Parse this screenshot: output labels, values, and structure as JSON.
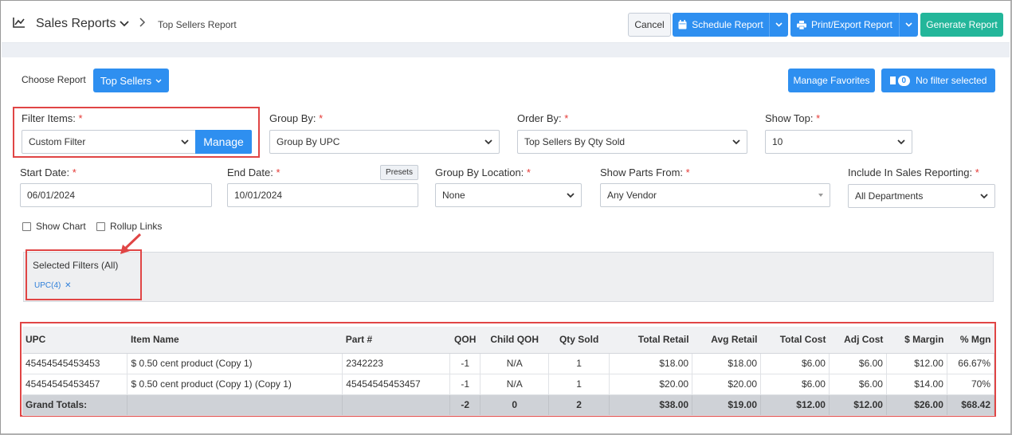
{
  "header": {
    "title": "Sales Reports",
    "subtitle": "Top Sellers Report",
    "cancel_label": "Cancel",
    "schedule_label": "Schedule Report",
    "print_label": "Print/Export Report",
    "generate_label": "Generate Report"
  },
  "choose": {
    "label": "Choose Report",
    "report_button": "Top Sellers",
    "favorites_button": "Manage Favorites",
    "filter_count": "0",
    "filter_status": "No filter selected"
  },
  "form": {
    "filter_items": {
      "label": "Filter Items:",
      "required": "*",
      "value": "Custom Filter",
      "manage": "Manage"
    },
    "group_by": {
      "label": "Group By:",
      "required": "*",
      "value": "Group By UPC"
    },
    "order_by": {
      "label": "Order By:",
      "required": "*",
      "value": "Top Sellers By Qty Sold"
    },
    "show_top": {
      "label": "Show Top:",
      "required": "*",
      "value": "10"
    },
    "start_date": {
      "label": "Start Date:",
      "required": "*",
      "value": "06/01/2024"
    },
    "end_date": {
      "label": "End Date:",
      "required": "*",
      "value": "10/01/2024",
      "presets": "Presets"
    },
    "group_by_location": {
      "label": "Group By Location:",
      "required": "*",
      "value": "None"
    },
    "show_parts_from": {
      "label": "Show Parts From:",
      "required": "*",
      "value": "Any Vendor"
    },
    "include_sales": {
      "label": "Include In Sales Reporting:",
      "required": "*",
      "value": "All Departments"
    },
    "show_chart": "Show Chart",
    "rollup_links": "Rollup Links"
  },
  "selected_filters": {
    "title": "Selected Filters (All)",
    "tag": "UPC(4)"
  },
  "table": {
    "headers": [
      "UPC",
      "Item Name",
      "Part #",
      "QOH",
      "Child QOH",
      "Qty Sold",
      "Total Retail",
      "Avg Retail",
      "Total Cost",
      "Adj Cost",
      "$ Margin",
      "% Mgn"
    ],
    "rows": [
      [
        "45454545453453",
        "$ 0.50 cent product (Copy 1)",
        "2342223",
        "-1",
        "N/A",
        "1",
        "$18.00",
        "$18.00",
        "$6.00",
        "$6.00",
        "$12.00",
        "66.67%"
      ],
      [
        "45454545453457",
        "$ 0.50 cent product (Copy 1) (Copy 1)",
        "45454545453457",
        "-1",
        "N/A",
        "1",
        "$20.00",
        "$20.00",
        "$6.00",
        "$6.00",
        "$14.00",
        "70%"
      ]
    ],
    "totals": [
      "Grand Totals:",
      "",
      "",
      "-2",
      "0",
      "2",
      "$38.00",
      "$19.00",
      "$12.00",
      "$12.00",
      "$26.00",
      "$68.42"
    ]
  },
  "colors": {
    "primary": "#2e8ff0",
    "success": "#23b69a",
    "highlight": "#e04545"
  }
}
